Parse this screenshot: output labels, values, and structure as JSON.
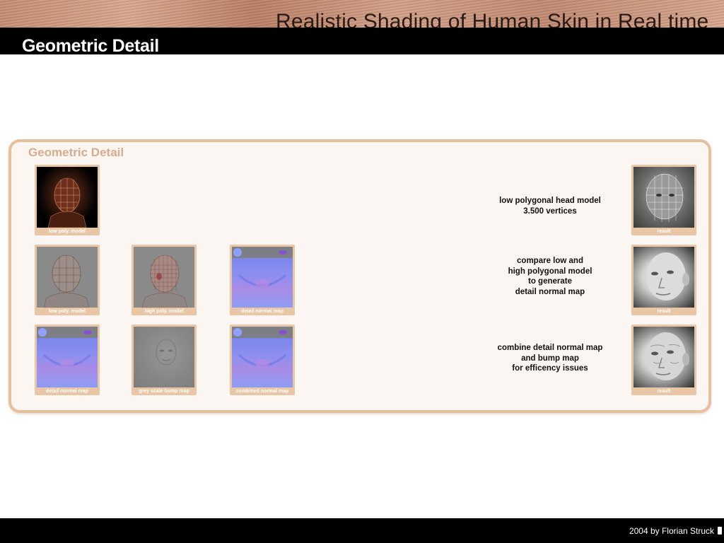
{
  "header": {
    "banner_title": "Realistic Shading of Human Skin in Real time",
    "slide_title": "Geometric Detail"
  },
  "panel": {
    "title": "Geometric Detail",
    "rows": [
      {
        "thumbs": [
          "low poly. model"
        ],
        "description": [
          "low polygonal head model",
          "3.500 vertices"
        ],
        "result_caption": "result"
      },
      {
        "thumbs": [
          "low poly. model",
          "high poly. model",
          "detail normal map"
        ],
        "description": [
          "compare low and",
          "high polygonal model",
          "to generate",
          "detail normal map"
        ],
        "result_caption": "result"
      },
      {
        "thumbs": [
          "detail normal map",
          "grey scale  bump map",
          "combined normal map"
        ],
        "description": [
          "combine detail normal map",
          "and bump map",
          "for efficency issues"
        ],
        "result_caption": "result"
      }
    ]
  },
  "footer": {
    "credit": "2004 by Florian Struck"
  },
  "colors": {
    "panel_border": "#e6bf9c",
    "panel_bg": "#fbf6f1",
    "title_accent": "#d4ac8e"
  }
}
